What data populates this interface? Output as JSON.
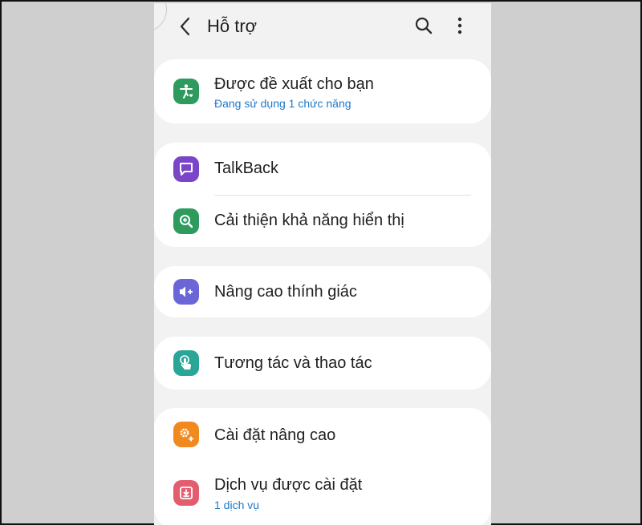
{
  "header": {
    "title": "Hỗ trợ",
    "back_icon": "chevron-left-icon",
    "search_icon": "search-icon",
    "more_icon": "more-vert-icon"
  },
  "items": [
    {
      "label": "Được đề xuất cho bạn",
      "sub": "Đang sử dụng 1 chức năng",
      "icon": "accessibility-person-icon",
      "color": "#2e9a5e"
    },
    {
      "label": "TalkBack",
      "icon": "chat-bubble-icon",
      "color": "#7a45c6"
    },
    {
      "label": "Cải thiện khả năng hiển thị",
      "icon": "zoom-in-icon",
      "color": "#2e9a5e"
    },
    {
      "label": "Nâng cao thính giác",
      "icon": "volume-plus-icon",
      "color": "#6b66d8"
    },
    {
      "label": "Tương tác và thao tác",
      "icon": "touch-hand-icon",
      "color": "#2aa699"
    },
    {
      "label": "Cài đặt nâng cao",
      "icon": "gear-plus-icon",
      "color": "#f08a1e"
    },
    {
      "label": "Dịch vụ được cài đặt",
      "sub": "1 dịch vụ",
      "icon": "download-box-icon",
      "color": "#e35d6f"
    }
  ]
}
